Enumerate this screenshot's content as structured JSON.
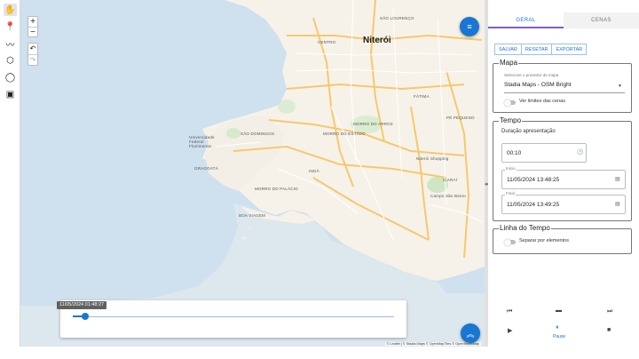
{
  "toolbar": {
    "items": [
      {
        "name": "hand-icon",
        "glyph": "✋"
      },
      {
        "name": "pin-icon",
        "glyph": "📍"
      },
      {
        "name": "polyline-icon",
        "glyph": "〰"
      },
      {
        "name": "polygon-icon",
        "glyph": "⬡"
      },
      {
        "name": "circle-icon",
        "glyph": "◯"
      },
      {
        "name": "image-icon",
        "glyph": "▣"
      }
    ]
  },
  "map": {
    "zoom_in": "+",
    "zoom_out": "−",
    "undo": "↶",
    "redo": "↷",
    "labels": {
      "city": "Niterói",
      "sao_lourenco": "SÃO LOURENÇO",
      "centro": "CENTRO",
      "fatima": "FÁTIMA",
      "pe_pequeno": "PÉ PEQUENO",
      "morro_arroz": "MORRO DO ARROZ",
      "morro_estado": "MORRO DO ESTADO",
      "sao_domingos": "SÃO DOMINGOS",
      "inga": "INGÁ",
      "gragoata": "GRAGOATÁ",
      "morro_palacio": "MORRO DO PALÁCIO",
      "boa_viagem": "BOA VIAGEM",
      "icarai": "ICARAÍ",
      "niteroi_shopping": "Niterói Shopping",
      "campo": "Campo São Bento",
      "uff": "Universidade Federal Fluminense"
    },
    "attribution": "© Leaflet | © Stadia Maps © OpenMapTiles © OpenStreetMap"
  },
  "timeline": {
    "tooltip": "11/05/2024 01:48:27",
    "progress": 0.04
  },
  "panel": {
    "tabs": [
      {
        "label": "Geral",
        "active": true
      },
      {
        "label": "Cenas",
        "active": false
      }
    ],
    "actions": {
      "save": "Salvar",
      "reset": "Resetar",
      "export": "Exportar"
    },
    "mapa": {
      "title": "Mapa",
      "tile_label": "Selecione o provedor de mapa",
      "tile_value": "Stadia Maps - OSM Bright",
      "show_limits": "Ver limites das cenas"
    },
    "tempo": {
      "title": "Tempo",
      "duration_label": "Duração apresentação",
      "duration_value": "00:10",
      "start_label": "Início",
      "start_value": "11/05/2024 13:48:25",
      "end_label": "Final",
      "end_value": "11/05/2024 13:49:25"
    },
    "linha": {
      "title": "Linha do Tempo",
      "separate": "Separar por elementos"
    },
    "controls": {
      "prev": "⏮",
      "screen": "▬",
      "next": "⏭",
      "play": "▶",
      "pause": "⏸",
      "pause_label": "Pause",
      "stop": "■"
    }
  },
  "colors": {
    "accent": "#1976d2",
    "water": "#cfe0ee",
    "land": "#f6f2ea",
    "tab_underline": "#7b5ce0"
  }
}
